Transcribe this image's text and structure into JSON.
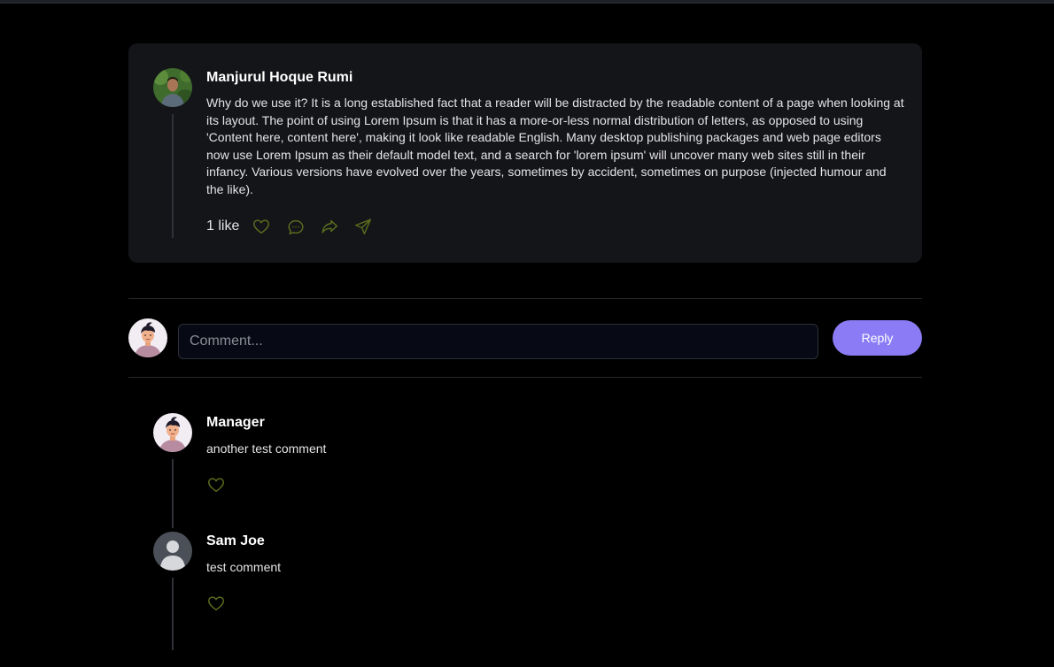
{
  "post": {
    "author": "Manjurul Hoque Rumi",
    "body": "Why do we use it? It is a long established fact that a reader will be distracted by the readable content of a page when looking at its layout. The point of using Lorem Ipsum is that it has a more-or-less normal distribution of letters, as opposed to using 'Content here, content here', making it look like readable English. Many desktop publishing packages and web page editors now use Lorem Ipsum as their default model text, and a search for 'lorem ipsum' will uncover many web sites still in their infancy. Various versions have evolved over the years, sometimes by accident, sometimes on purpose (injected humour and the like).",
    "likes": "1 like",
    "actions": [
      "heart-icon",
      "comment-icon",
      "share-icon",
      "send-icon"
    ]
  },
  "composer": {
    "placeholder": "Comment...",
    "reply_label": "Reply"
  },
  "comments": [
    {
      "author": "Manager",
      "text": "another test comment",
      "avatar": "cartoon-avatar"
    },
    {
      "author": "Sam Joe",
      "text": "test comment",
      "avatar": "default-user-avatar"
    }
  ],
  "colors": {
    "background": "#000000",
    "card": "#141518",
    "accent": "#8b7cf6",
    "icon": "#5a6b1e"
  }
}
